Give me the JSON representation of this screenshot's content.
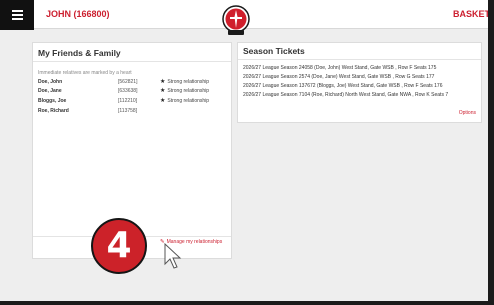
{
  "header": {
    "user_label": "JOHN (166800)",
    "basket_label": "BASKET",
    "menu_icon": "hamburger-menu-icon",
    "logo_icon": "club-crest-logo",
    "brand_color": "#cc1f2f"
  },
  "friends_panel": {
    "title": "My Friends & Family",
    "subtitle": "Immediate relatives are marked by a heart",
    "members": [
      {
        "name": "Doe, John",
        "id": "[562821]",
        "relationship": "Strong relationship"
      },
      {
        "name": "Doe, Jane",
        "id": "[633638]",
        "relationship": "Strong relationship"
      },
      {
        "name": "Bloggs, Joe",
        "id": "[112210]",
        "relationship": "Strong relationship"
      },
      {
        "name": "Roe, Richard",
        "id": "[113758]",
        "relationship": ""
      }
    ],
    "manage_link": "Manage my relationships"
  },
  "tickets_panel": {
    "title": "Season Tickets",
    "rows": [
      "2026/27  League Season 24058 (Doe, John) West Stand, Gate WSB , Row F Seats 175",
      "2026/27  League Season 2574 (Doe, Jane) West Stand, Gate WSB , Row G Seats 177",
      "2026/27  League Season 137672 (Bloggs, Joe) West Stand, Gate WSB , Row F Seats 176",
      "2026/27  League Season 7104 (Roe, Richard) North West Stand, Gate NWA , Row K Seats 7"
    ],
    "options_link": "Options"
  },
  "tutorial": {
    "step_number": "4"
  }
}
